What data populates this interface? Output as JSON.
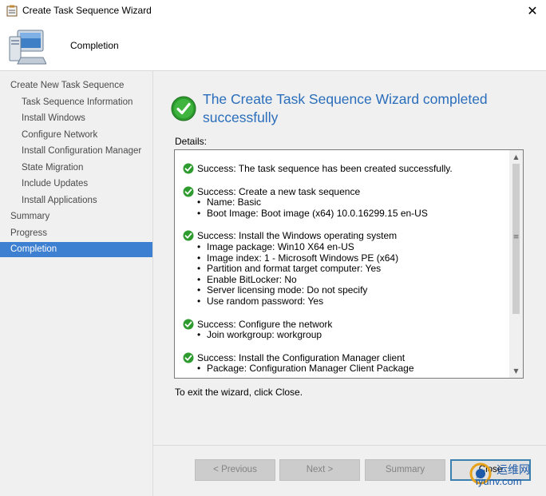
{
  "window": {
    "title": "Create Task Sequence Wizard",
    "close_glyph": "✕"
  },
  "header": {
    "title": "Completion",
    "icon": "computer-icon"
  },
  "sidebar": {
    "items": [
      {
        "label": "Create New Task Sequence",
        "level": 0
      },
      {
        "label": "Task Sequence Information",
        "level": 1
      },
      {
        "label": "Install Windows",
        "level": 1
      },
      {
        "label": "Configure Network",
        "level": 1
      },
      {
        "label": "Install Configuration Manager",
        "level": 1
      },
      {
        "label": "State Migration",
        "level": 1
      },
      {
        "label": "Include Updates",
        "level": 1
      },
      {
        "label": "Install Applications",
        "level": 1
      },
      {
        "label": "Summary",
        "level": 0
      },
      {
        "label": "Progress",
        "level": 0
      },
      {
        "label": "Completion",
        "level": 0,
        "active": true
      }
    ]
  },
  "main": {
    "heading": "The Create Task Sequence Wizard completed successfully",
    "details_label": "Details:",
    "details": [
      {
        "head": "Success: The task sequence has been created successfully.",
        "bullets": []
      },
      {
        "head": "Success: Create a new task sequence",
        "bullets": [
          "Name: Basic",
          "Boot Image: Boot image (x64) 10.0.16299.15 en-US"
        ]
      },
      {
        "head": "Success: Install the Windows operating system",
        "bullets": [
          "Image package: Win10 X64  en-US",
          "Image index: 1 - Microsoft Windows PE (x64)",
          "Partition and format target computer: Yes",
          "Enable BitLocker: No",
          "Server licensing mode: Do not specify",
          "Use random password: Yes"
        ]
      },
      {
        "head": "Success: Configure the network",
        "bullets": [
          "Join workgroup: workgroup"
        ]
      },
      {
        "head": "Success: Install the Configuration Manager client",
        "bullets": [
          "Package: Configuration Manager Client Package"
        ]
      }
    ],
    "exit_text": "To exit the wizard, click Close."
  },
  "buttons": {
    "previous": "< Previous",
    "next": "Next >",
    "summary": "Summary",
    "close": "Close"
  },
  "watermark": {
    "line1": "运维网",
    "line2": "iyunv.com"
  },
  "colors": {
    "accent": "#3d7fd1",
    "heading": "#2a6ebb",
    "success": "#2e9b2e"
  }
}
